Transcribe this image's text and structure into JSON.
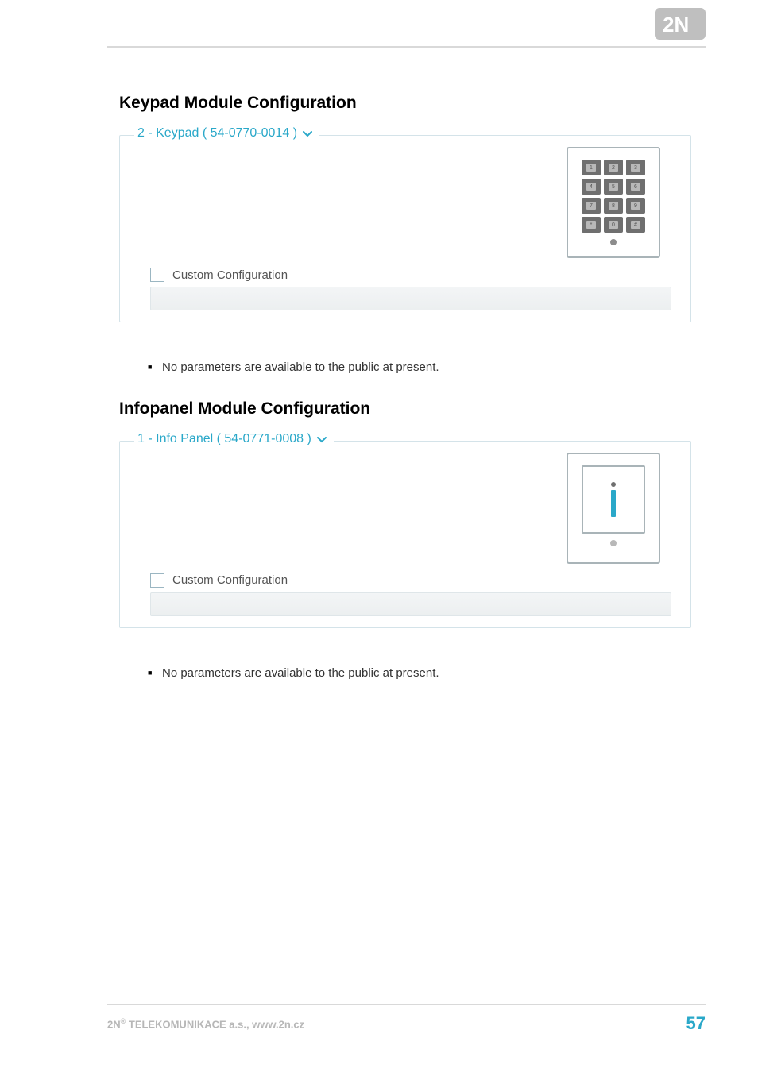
{
  "logo": {
    "brand": "2N"
  },
  "sections": {
    "keypad": {
      "heading": "Keypad Module Configuration",
      "legend": "2 - Keypad ( 54-0770-0014 )",
      "keys": [
        "1",
        "2",
        "3",
        "4",
        "5",
        "6",
        "7",
        "8",
        "9",
        "*",
        "0",
        "#"
      ],
      "custom_config_label": "Custom Configuration",
      "bullet": "No parameters are available to the public at present."
    },
    "infopanel": {
      "heading": "Infopanel Module Configuration",
      "legend": "1 - Info Panel ( 54-0771-0008 )",
      "custom_config_label": "Custom Configuration",
      "bullet": "No parameters are available to the public at present."
    }
  },
  "footer": {
    "company_prefix": "2N",
    "reg": "®",
    "company_suffix": " TELEKOMUNIKACE a.s., www.2n.cz",
    "page": "57"
  }
}
